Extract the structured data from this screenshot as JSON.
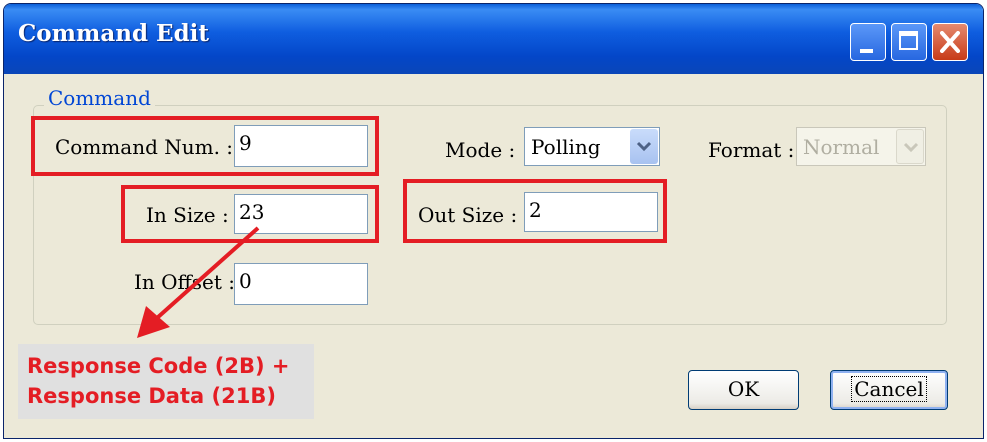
{
  "window": {
    "title": "Command Edit",
    "title_color": "#ffffff",
    "titlebar_color": "#0a5fd8"
  },
  "group": {
    "legend": "Command"
  },
  "fields": {
    "command_num": {
      "label": "Command Num. :",
      "value": "9"
    },
    "in_size": {
      "label": "In Size :",
      "value": "23"
    },
    "in_offset": {
      "label": "In Offset :",
      "value": "0"
    },
    "out_size": {
      "label": "Out Size :",
      "value": "2"
    },
    "mode": {
      "label": "Mode :",
      "value": "Polling"
    },
    "format": {
      "label": "Format :",
      "value": "Normal",
      "disabled": true
    }
  },
  "annotation": {
    "line1": "Response Code (2B) +",
    "line2": "Response Data (21B)",
    "color": "#e41d24"
  },
  "buttons": {
    "ok": "OK",
    "cancel": "Cancel"
  },
  "icons": {
    "minimize": "minimize-icon",
    "maximize": "maximize-icon",
    "close": "close-icon",
    "dropdown": "chevron-down-icon"
  }
}
